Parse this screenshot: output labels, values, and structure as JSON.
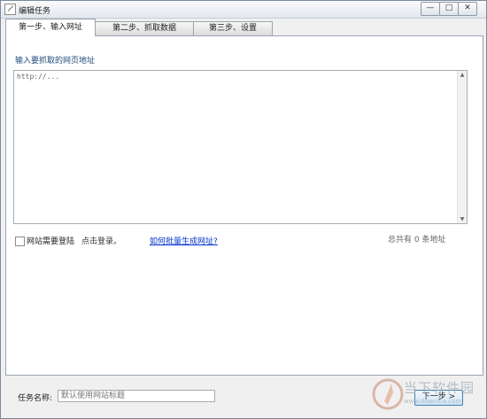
{
  "window": {
    "title": "编辑任务",
    "minimize": "—",
    "maximize": "□",
    "close": "✕"
  },
  "tabs": [
    {
      "label": "第一步、输入网址",
      "active": true
    },
    {
      "label": "第二步、抓取数据",
      "active": false
    },
    {
      "label": "第三步、设置",
      "active": false
    }
  ],
  "step1": {
    "section_label": "输入要抓取的网页地址",
    "url_value": "http://...",
    "login_checkbox_label": "网站需要登陆",
    "login_checked": false,
    "login_hint": "点击登录。",
    "batch_link": "如何批量生成网址?",
    "count_text": "总共有 0 条地址"
  },
  "footer": {
    "task_name_label": "任务名称:",
    "task_name_placeholder": "默认使用网站标题",
    "next_button": "下一步 >"
  },
  "watermark": {
    "text": "当下软件园",
    "url": "www.downxia.com"
  },
  "colors": {
    "accent": "#1e4a7a",
    "link": "#0033cc",
    "border": "#9aa4b0"
  }
}
